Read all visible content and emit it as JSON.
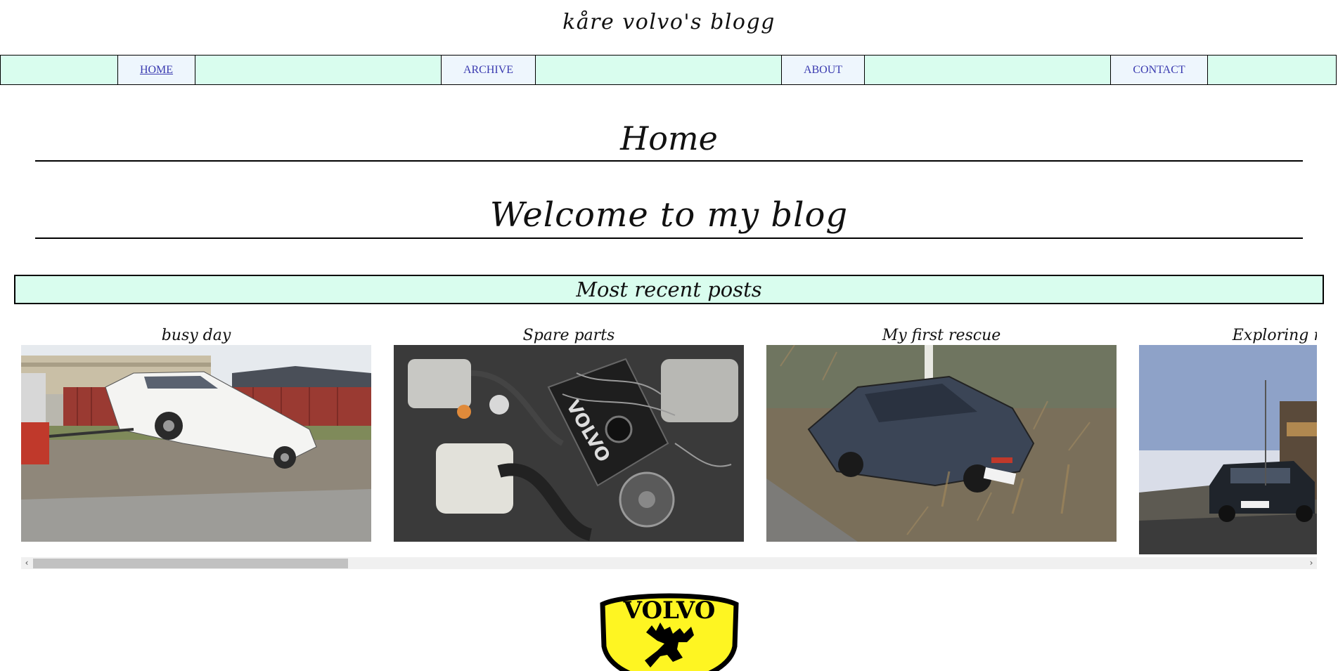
{
  "site": {
    "title": "kåre volvo's blogg"
  },
  "nav": {
    "items": [
      {
        "label": "HOME"
      },
      {
        "label": "ARCHIVE"
      },
      {
        "label": "ABOUT"
      },
      {
        "label": "CONTACT"
      }
    ]
  },
  "main": {
    "page_heading": "Home",
    "welcome_heading": "Welcome to my blog",
    "recent_posts_heading": "Most recent posts",
    "posts": [
      {
        "title": "busy day",
        "image": "white-car-being-towed-photo"
      },
      {
        "title": "Spare parts",
        "image": "volvo-engine-bay-photo"
      },
      {
        "title": "My first rescue",
        "image": "car-in-ditch-photo"
      },
      {
        "title": "Exploring mountains",
        "image": "dark-volvo-mountain-road-photo"
      }
    ]
  },
  "footer": {
    "logo_text": "VOLVO",
    "logo_icon": "moose-badge-icon"
  },
  "colors": {
    "nav_background": "#d9fdee",
    "nav_item_background": "#eef6fd",
    "link": "#3a3ab0",
    "logo_yellow": "#fef522"
  }
}
